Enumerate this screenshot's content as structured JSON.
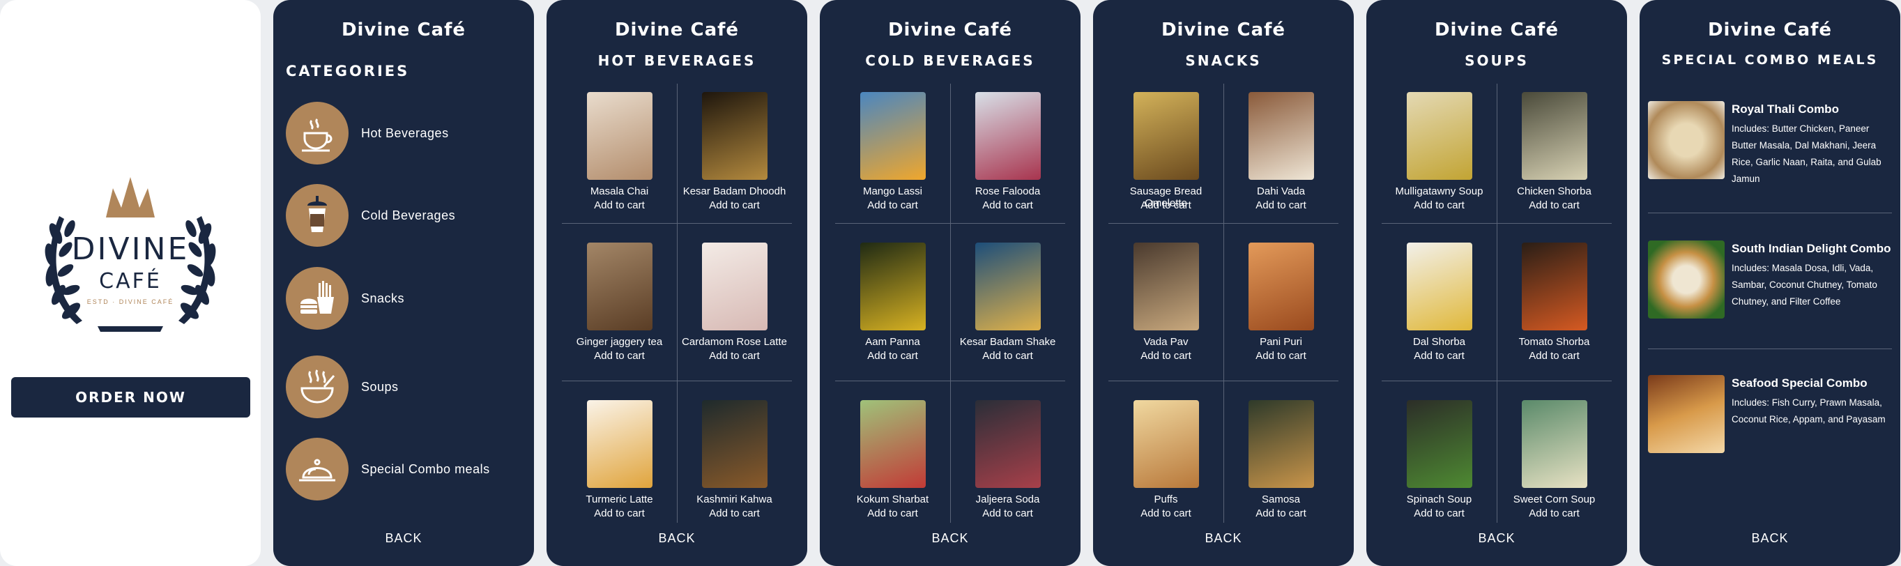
{
  "splash": {
    "logo_word1": "DIVINE",
    "logo_word2": "CAFÉ",
    "logo_tagline": "ESTD · DIVINE CAFÉ",
    "order_button": "ORDER NOW"
  },
  "brand": "Divine Café",
  "back_label": "BACK",
  "categories": {
    "title": "CATEGORIES",
    "items": [
      {
        "label": "Hot Beverages",
        "icon": "hot-cup-icon"
      },
      {
        "label": "Cold Beverages",
        "icon": "iced-drink-icon"
      },
      {
        "label": "Snacks",
        "icon": "fries-burger-icon"
      },
      {
        "label": "Soups",
        "icon": "soup-bowl-icon"
      },
      {
        "label": "Special Combo meals",
        "icon": "cloche-icon"
      }
    ]
  },
  "menus": [
    {
      "title": "HOT BEVERAGES",
      "items": [
        {
          "name": "Masala Chai",
          "action": "Add to cart",
          "color": "#c9a886"
        },
        {
          "name": "Kesar Badam Dhoodh",
          "action": "Add to cart",
          "color": "#3a2a18"
        },
        {
          "name": "Ginger jaggery tea",
          "action": "Add to cart",
          "color": "#8a6a4a"
        },
        {
          "name": "Cardamom Rose Latte",
          "action": "Add to cart",
          "color": "#e7dcd6"
        },
        {
          "name": "Turmeric Latte",
          "action": "Add to cart",
          "color": "#f0e6d6"
        },
        {
          "name": "Kashmiri Kahwa",
          "action": "Add to cart",
          "color": "#2b2a24"
        }
      ]
    },
    {
      "title": "COLD BEVERAGES",
      "items": [
        {
          "name": "Mango Lassi",
          "action": "Add to cart",
          "color": "#e8a634"
        },
        {
          "name": "Rose Falooda",
          "action": "Add to cart",
          "color": "#b84f6e"
        },
        {
          "name": "Aam Panna",
          "action": "Add to cart",
          "color": "#c8a41f"
        },
        {
          "name": "Kesar Badam Shake",
          "action": "Add to cart",
          "color": "#2f5e88"
        },
        {
          "name": "Kokum Sharbat",
          "action": "Add to cart",
          "color": "#c6413b"
        },
        {
          "name": "Jaljeera Soda",
          "action": "Add to cart",
          "color": "#3a3f4a"
        }
      ]
    },
    {
      "title": "SNACKS",
      "items": [
        {
          "name": "Sausage Bread Omelette",
          "action": "Add to cart",
          "color": "#a88a3a"
        },
        {
          "name": "Dahi Vada",
          "action": "Add to cart",
          "color": "#d9c7a8"
        },
        {
          "name": "Vada Pav",
          "action": "Add to cart",
          "color": "#8c7a62"
        },
        {
          "name": "Pani Puri",
          "action": "Add to cart",
          "color": "#c47a3a"
        },
        {
          "name": "Puffs",
          "action": "Add to cart",
          "color": "#d3a45e"
        },
        {
          "name": "Samosa",
          "action": "Add to cart",
          "color": "#7a6a3a"
        }
      ]
    },
    {
      "title": "SOUPS",
      "items": [
        {
          "name": "Mulligatawny Soup",
          "action": "Add to cart",
          "color": "#c9b04a"
        },
        {
          "name": "Chicken Shorba",
          "action": "Add to cart",
          "color": "#c8c2a6"
        },
        {
          "name": "Dal Shorba",
          "action": "Add to cart",
          "color": "#e0b83a"
        },
        {
          "name": "Tomato Shorba",
          "action": "Add to cart",
          "color": "#c5552a"
        },
        {
          "name": "Spinach Soup",
          "action": "Add to cart",
          "color": "#5d8a3a"
        },
        {
          "name": "Sweet Corn Soup",
          "action": "Add to cart",
          "color": "#b7c49a"
        }
      ]
    }
  ],
  "combos": {
    "title": "SPECIAL COMBO MEALS",
    "items": [
      {
        "name": "Royal Thali Combo",
        "desc": "Includes: Butter Chicken, Paneer Butter Masala, Dal Makhani, Jeera Rice, Garlic Naan, Raita, and Gulab Jamun",
        "color": "#cbb08a"
      },
      {
        "name": "South Indian Delight Combo",
        "desc": "Includes: Masala Dosa, Idli, Vada, Sambar, Coconut Chutney, Tomato Chutney, and Filter Coffee",
        "color": "#4f7a3a"
      },
      {
        "name": "Seafood Special Combo",
        "desc": "Includes: Fish Curry, Prawn Masala, Coconut Rice, Appam, and Payasam",
        "color": "#b8743a"
      }
    ]
  },
  "colors": {
    "panel": "#1a2740",
    "accent": "#b0865a"
  }
}
